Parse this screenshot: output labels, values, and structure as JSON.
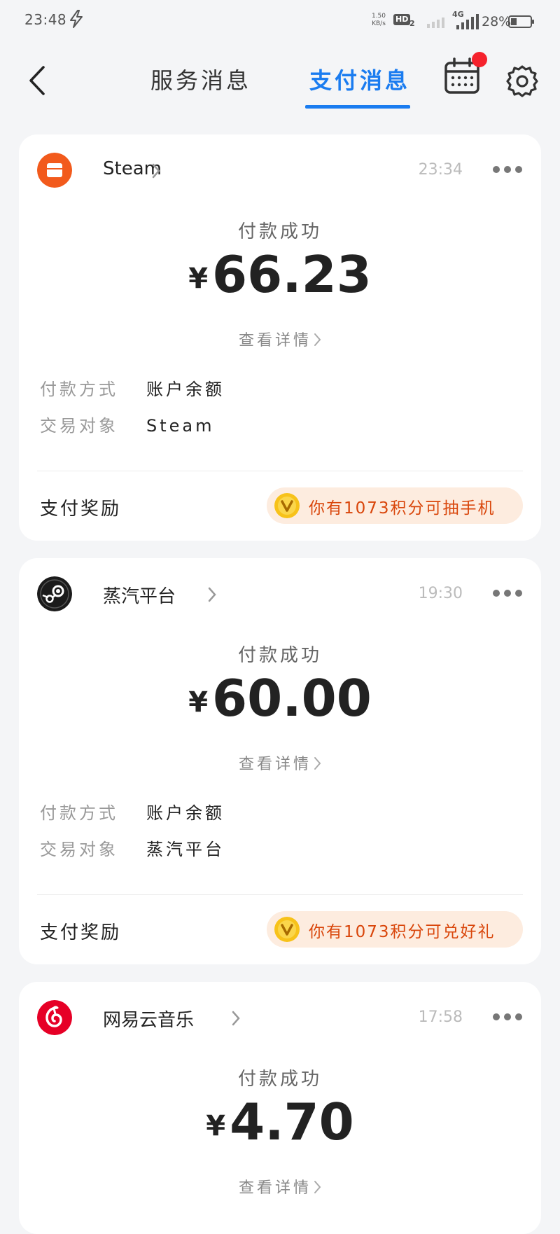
{
  "status_bar": {
    "time": "23:48",
    "net_speed_value": "1.50",
    "net_speed_unit": "KB/s",
    "hd_label": "HD",
    "hd_sub": "2",
    "network_type": "4G",
    "battery": "28%"
  },
  "header": {
    "tabs": [
      {
        "label": "服务消息",
        "active": false
      },
      {
        "label": "支付消息",
        "active": true
      }
    ],
    "calendar_has_notification": true
  },
  "cards": [
    {
      "merchant": "Steam",
      "time": "23:34",
      "status": "付款成功",
      "currency": "¥",
      "amount": "66.23",
      "details_link": "查看详情",
      "payment_method_label": "付款方式",
      "payment_method": "账户余额",
      "counterparty_label": "交易对象",
      "counterparty": "Steam",
      "reward_label": "支付奖励",
      "reward_text": "你有1073积分可抽手机",
      "logo": "steam-store-logo"
    },
    {
      "merchant": "蒸汽平台",
      "time": "19:30",
      "status": "付款成功",
      "currency": "¥",
      "amount": "60.00",
      "details_link": "查看详情",
      "payment_method_label": "付款方式",
      "payment_method": "账户余额",
      "counterparty_label": "交易对象",
      "counterparty": "蒸汽平台",
      "reward_label": "支付奖励",
      "reward_text": "你有1073积分可兑好礼",
      "logo": "steam-platform-logo"
    },
    {
      "merchant": "网易云音乐",
      "time": "17:58",
      "status": "付款成功",
      "currency": "¥",
      "amount": "4.70",
      "details_link": "查看详情",
      "logo": "netease-music-logo"
    }
  ],
  "colors": {
    "accent": "#1a7cf0",
    "notification": "#f5222d",
    "reward_text": "#d9460b",
    "reward_bg": "#fdecdf",
    "steam_orange": "#f25a1c",
    "netease_red": "#e60026"
  }
}
